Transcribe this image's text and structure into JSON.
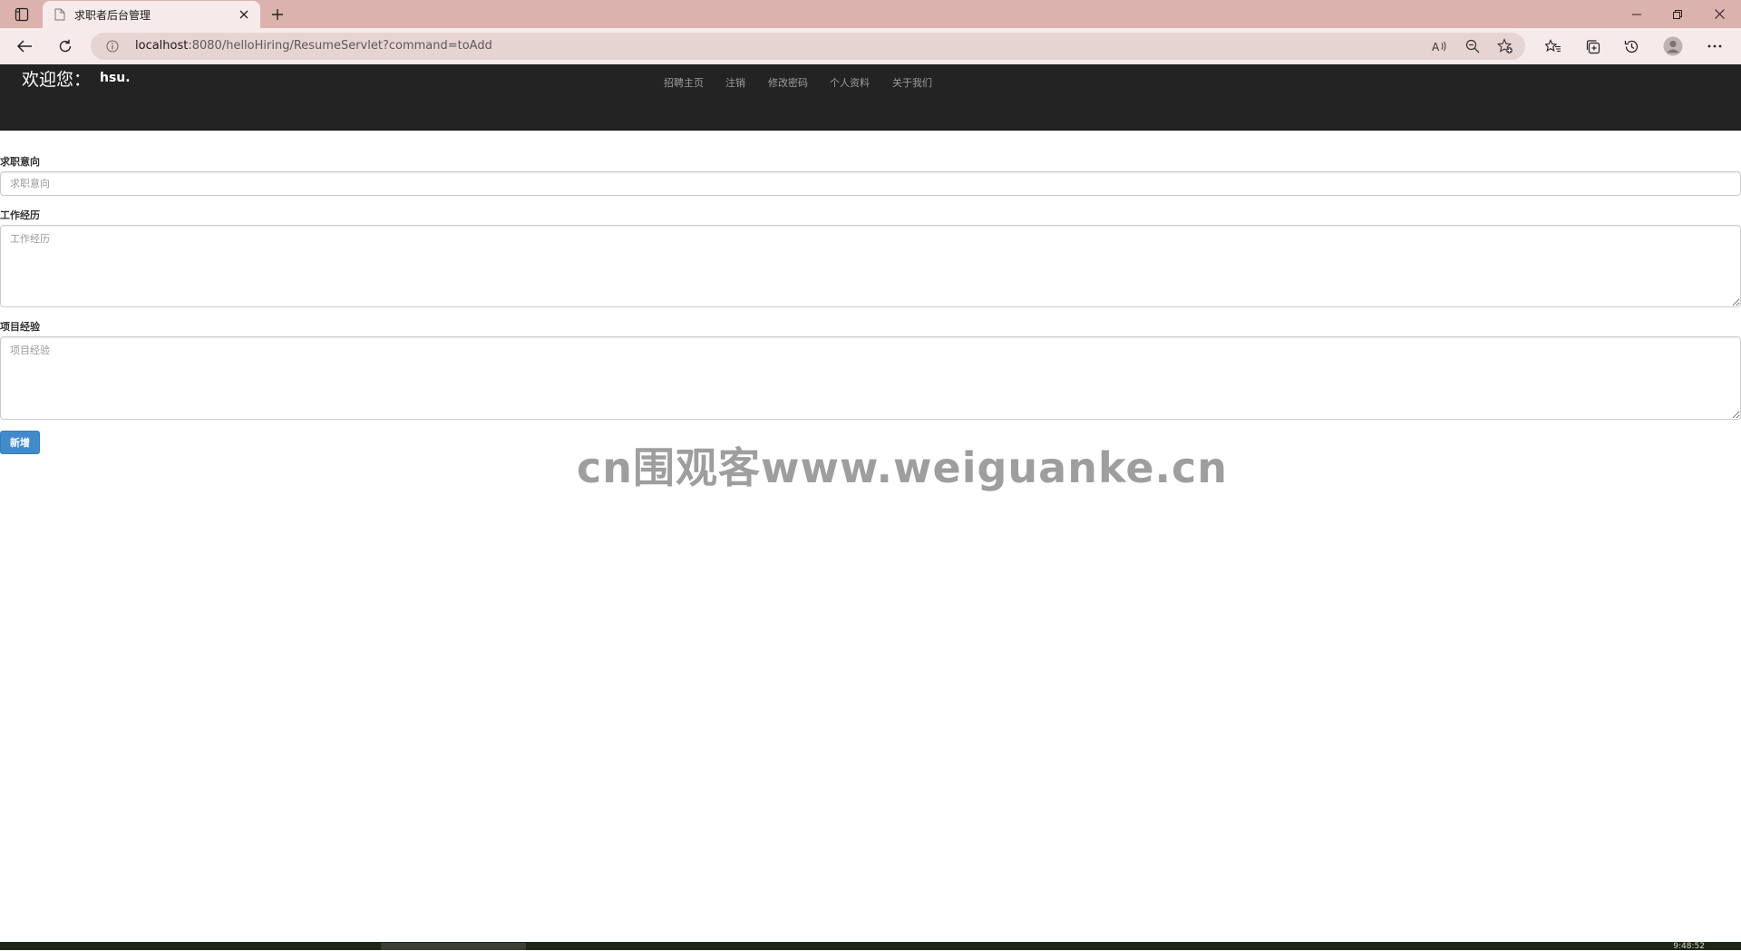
{
  "browser": {
    "tab_title": "求职者后台管理",
    "url_host": "localhost",
    "url_path": ":8080/helloHiring/ResumeServlet?command=toAdd"
  },
  "header": {
    "welcome": "欢迎您：",
    "username": "hsu.",
    "nav": [
      "招聘主页",
      "注销",
      "修改密码",
      "个人资料",
      "关于我们"
    ]
  },
  "form": {
    "intention_label": "求职意向",
    "intention_placeholder": "求职意向",
    "intention_value": "",
    "work_label": "工作经历",
    "work_placeholder": "工作经历",
    "work_value": "",
    "project_label": "项目经验",
    "project_placeholder": "项目经验",
    "project_value": "",
    "submit_label": "新增"
  },
  "watermark": "cn围观客www.weiguanke.cn",
  "taskbar": {
    "clock": "9:48:52"
  },
  "colors": {
    "tab_strip": "#dcb2ae",
    "toolbar": "#f6ebea",
    "header_bg": "#232323",
    "primary_button": "#428bca"
  },
  "icons": [
    "tab-actions-icon",
    "page-icon",
    "close-icon",
    "plus-icon",
    "minimize-icon",
    "restore-icon",
    "back-icon",
    "refresh-icon",
    "info-icon",
    "read-aloud-icon",
    "zoom-out-icon",
    "add-favorite-icon",
    "favorites-icon",
    "collections-icon",
    "history-icon",
    "profile-icon",
    "more-icon"
  ]
}
